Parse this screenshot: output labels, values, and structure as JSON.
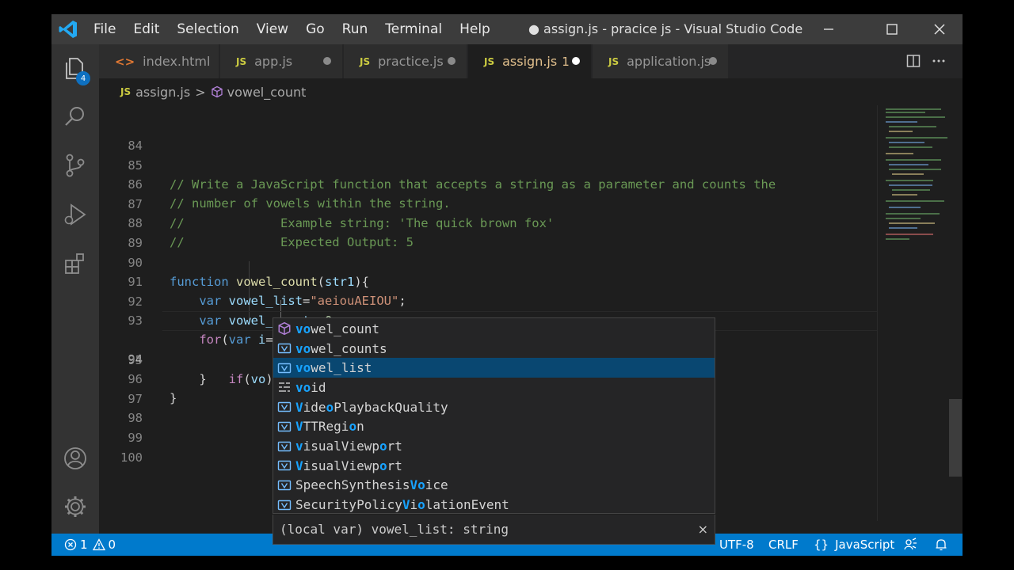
{
  "titlebar": {
    "menu": [
      "File",
      "Edit",
      "Selection",
      "View",
      "Go",
      "Run",
      "Terminal",
      "Help"
    ],
    "title": "● assign.js - pracice js - Visual Studio Code"
  },
  "activitybar": {
    "explorer_badge": "4"
  },
  "tabs": [
    {
      "name": "index.html",
      "type": "html",
      "dirty": false,
      "active": false
    },
    {
      "name": "app.js",
      "type": "js",
      "dirty": true,
      "active": false
    },
    {
      "name": "practice.js",
      "type": "js",
      "dirty": true,
      "active": false
    },
    {
      "name": "assign.js",
      "type": "js",
      "dirty": true,
      "active": true,
      "problems": "1"
    },
    {
      "name": "application.js",
      "type": "js",
      "dirty": true,
      "active": false
    }
  ],
  "breadcrumb": {
    "file_icon": "JS",
    "file": "assign.js",
    "separator": ">",
    "symbol": "vowel_count"
  },
  "lang_icon_text": "JS",
  "editor": {
    "line_numbers": [
      "84",
      "85",
      "86",
      "87",
      "88",
      "89",
      "90",
      "91",
      "92",
      "93",
      "94",
      "95",
      "96",
      "97",
      "98",
      "99",
      "100"
    ],
    "current_line": "94"
  },
  "suggestions": [
    {
      "text": "vowel_count",
      "kind": "function",
      "selected": false
    },
    {
      "text": "vowel_counts",
      "kind": "variable",
      "selected": false
    },
    {
      "text": "vowel_list",
      "kind": "variable",
      "selected": true
    },
    {
      "text": "void",
      "kind": "keyword",
      "selected": false
    },
    {
      "text": "VideoPlaybackQuality",
      "kind": "variable",
      "selected": false
    },
    {
      "text": "VTTRegion",
      "kind": "variable",
      "selected": false
    },
    {
      "text": "visualViewport",
      "kind": "variable",
      "selected": false
    },
    {
      "text": "VisualViewport",
      "kind": "variable",
      "selected": false
    },
    {
      "text": "SpeechSynthesisVoice",
      "kind": "variable",
      "selected": false
    },
    {
      "text": "SecurityPolicyViolationEvent",
      "kind": "variable",
      "selected": false
    }
  ],
  "suggest_details": {
    "text": "(local var) vowel_list: string",
    "close": "×"
  },
  "statusbar": {
    "errors": "1",
    "warnings": "0",
    "encoding": "UTF-8",
    "eol": "CRLF",
    "language_braces": "{}",
    "language": "JavaScript"
  },
  "colors": {
    "accent": "#007acc",
    "selection": "#094771",
    "match": "#18a3ff"
  }
}
